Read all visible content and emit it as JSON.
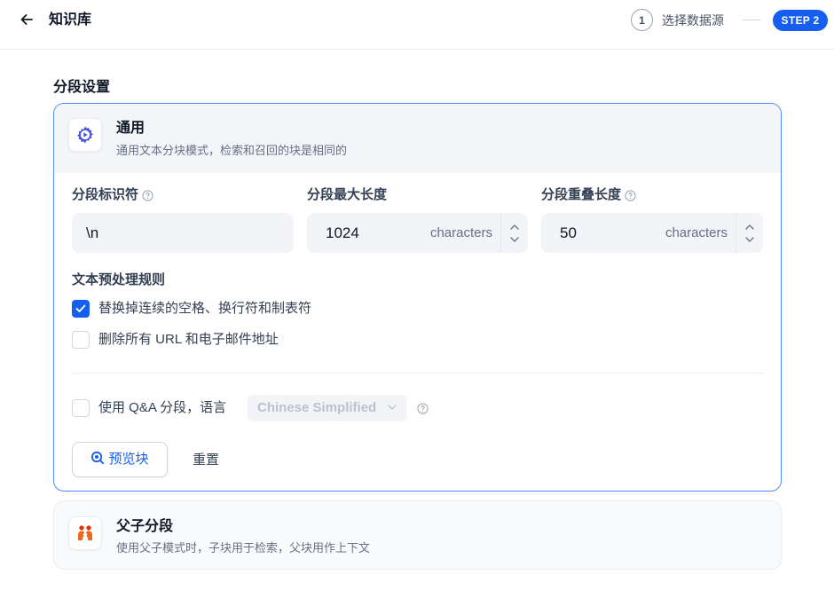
{
  "header": {
    "title": "知识库",
    "steps": [
      {
        "number": "1",
        "label": "选择数据源"
      },
      {
        "label": "STEP 2"
      }
    ]
  },
  "section_title": "分段设置",
  "general_card": {
    "title": "通用",
    "description": "通用文本分块模式，检索和召回的块是相同的",
    "fields": {
      "separator": {
        "label": "分段标识符",
        "value": "\\n"
      },
      "max_length": {
        "label": "分段最大长度",
        "value": "1024",
        "unit": "characters"
      },
      "overlap": {
        "label": "分段重叠长度",
        "value": "50",
        "unit": "characters"
      }
    },
    "rules": {
      "title": "文本预处理规则",
      "items": [
        {
          "label": "替换掉连续的空格、换行符和制表符",
          "checked": true
        },
        {
          "label": "删除所有 URL 和电子邮件地址",
          "checked": false
        }
      ]
    },
    "qa": {
      "label": "使用 Q&A 分段，语言",
      "checked": false,
      "language": "Chinese Simplified"
    },
    "buttons": {
      "preview": "预览块",
      "reset": "重置"
    }
  },
  "parent_child_card": {
    "title": "父子分段",
    "description": "使用父子模式时，子块用于检索，父块用作上下文"
  },
  "colors": {
    "accent": "#155eef",
    "icon_purple": "#444ce7",
    "icon_orange": "#e62e05"
  }
}
